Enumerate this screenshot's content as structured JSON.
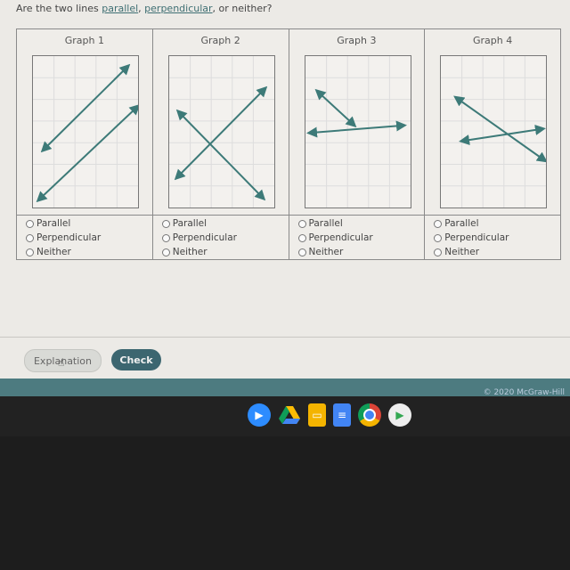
{
  "question": {
    "prefix": "Are the two lines ",
    "link1": "parallel",
    "sep": ", ",
    "link2": "perpendicular",
    "suffix": ", or neither?"
  },
  "graphs": [
    {
      "title": "Graph 1",
      "options": [
        "Parallel",
        "Perpendicular",
        "Neither"
      ]
    },
    {
      "title": "Graph 2",
      "options": [
        "Parallel",
        "Perpendicular",
        "Neither"
      ]
    },
    {
      "title": "Graph 3",
      "options": [
        "Parallel",
        "Perpendicular",
        "Neither"
      ]
    },
    {
      "title": "Graph 4",
      "options": [
        "Parallel",
        "Perpendicular",
        "Neither"
      ]
    }
  ],
  "buttons": {
    "explanation": "Explanation",
    "check": "Check"
  },
  "footer": {
    "copyright": "© 2020 McGraw-Hill"
  },
  "shelf": {
    "apps": [
      "zoom-icon",
      "google-drive-icon",
      "google-slides-icon",
      "google-docs-icon",
      "chrome-icon",
      "play-store-icon"
    ]
  },
  "colors": {
    "line": "#3d7a78",
    "check_button": "#3c6670",
    "footer": "#4d7b80"
  }
}
